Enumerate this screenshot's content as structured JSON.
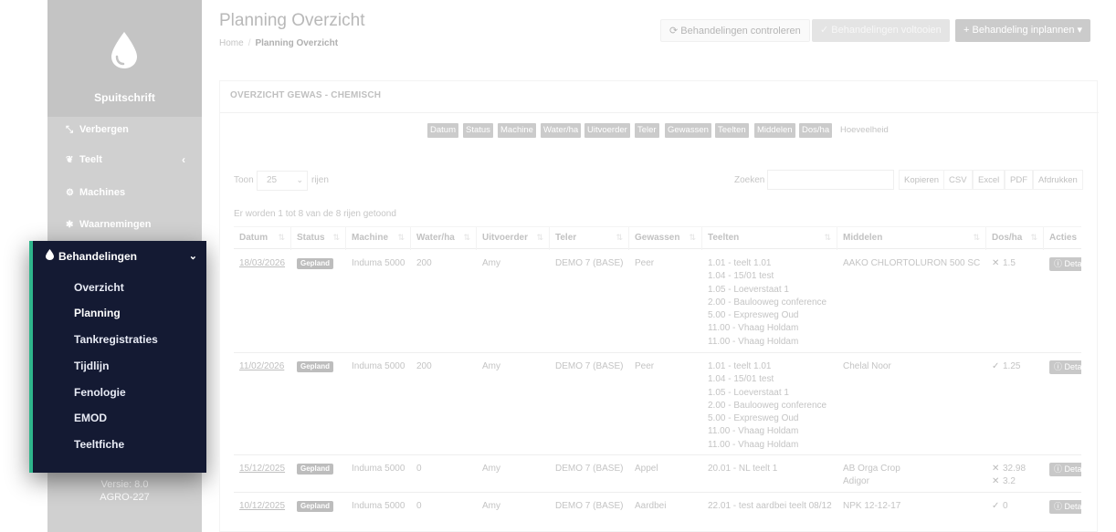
{
  "app": {
    "name": "Spuitschrift",
    "version": "Versie: 8.0",
    "build": "AGRO-227"
  },
  "sidebar": {
    "items": [
      {
        "icon": "compress-icon",
        "label": "Verbergen"
      },
      {
        "icon": "leaf-icon",
        "label": "Teelt"
      },
      {
        "icon": "tractor-icon",
        "label": "Machines"
      },
      {
        "icon": "bug-icon",
        "label": "Waarnemingen"
      }
    ],
    "active_section": {
      "label": "Behandelingen",
      "icon": "drop-icon",
      "subitems": [
        "Overzicht",
        "Planning",
        "Tankregistraties",
        "Tijdlijn",
        "Fenologie",
        "EMOD",
        "Teeltfiche"
      ],
      "active": "Planning"
    }
  },
  "header": {
    "title": "Planning Overzicht",
    "breadcrumb": [
      "Home",
      "Planning Overzicht"
    ],
    "buttons": {
      "check": "Behandelingen controleren",
      "complete": "Behandelingen voltooien",
      "plan": "Behandeling inplannen"
    }
  },
  "panel": {
    "title": "OVERZICHT GEWAS - CHEMISCH",
    "column_toggles": [
      "Datum",
      "Status",
      "Machine",
      "Water/ha",
      "Uitvoerder",
      "Teler",
      "Gewassen",
      "Teelten",
      "Middelen",
      "Dos/ha"
    ],
    "column_toggle_off": "Hoeveelheid",
    "show_label": "Toon",
    "show_value": "25",
    "rows_label": "rijen",
    "search_label": "Zoeken",
    "export": [
      "Kopieren",
      "CSV",
      "Excel",
      "PDF",
      "Afdrukken"
    ],
    "info": "Er worden 1 tot 8 van de 8 rijen getoond"
  },
  "table": {
    "headers": [
      "Datum",
      "Status",
      "Machine",
      "Water/ha",
      "Uitvoerder",
      "Teler",
      "Gewassen",
      "Teelten",
      "Middelen",
      "Dos/ha",
      "Acties"
    ],
    "rows": [
      {
        "date": "18/03/2026",
        "status": "Gepland",
        "machine": "Induma 5000",
        "water": "200",
        "uitvoerder": "Amy",
        "teler": "DEMO 7 (BASE)",
        "gewas": "Peer",
        "teelten": [
          "1.01 - teelt 1.01",
          "1.04 - 15/01 test",
          "1.05 - Loeverstaat 1",
          "2.00 - Baulooweg conference",
          "5.00 - Expresweg Oud",
          "11.00 - Vhaag Holdam",
          "11.00 - Vhaag Holdam"
        ],
        "middelen": [
          "AAKO CHLORTOLURON 500 SC"
        ],
        "dos": [
          {
            "mark": "✕",
            "value": "1.5"
          }
        ],
        "action": "Details"
      },
      {
        "date": "11/02/2026",
        "status": "Gepland",
        "machine": "Induma 5000",
        "water": "200",
        "uitvoerder": "Amy",
        "teler": "DEMO 7 (BASE)",
        "gewas": "Peer",
        "teelten": [
          "1.01 - teelt 1.01",
          "1.04 - 15/01 test",
          "1.05 - Loeverstaat 1",
          "2.00 - Baulooweg conference",
          "5.00 - Expresweg Oud",
          "11.00 - Vhaag Holdam",
          "11.00 - Vhaag Holdam"
        ],
        "middelen": [
          "Chelal Noor"
        ],
        "dos": [
          {
            "mark": "✓",
            "value": "1.25"
          }
        ],
        "action": "Details"
      },
      {
        "date": "15/12/2025",
        "status": "Gepland",
        "machine": "Induma 5000",
        "water": "0",
        "uitvoerder": "Amy",
        "teler": "DEMO 7 (BASE)",
        "gewas": "Appel",
        "teelten": [
          "20.01 - NL teelt 1"
        ],
        "middelen": [
          "AB Orga Crop",
          "Adigor"
        ],
        "dos": [
          {
            "mark": "✕",
            "value": "32.98"
          },
          {
            "mark": "✕",
            "value": "3.2"
          }
        ],
        "action": "Details"
      },
      {
        "date": "10/12/2025",
        "status": "Gepland",
        "machine": "Induma 5000",
        "water": "0",
        "uitvoerder": "Amy",
        "teler": "DEMO 7 (BASE)",
        "gewas": "Aardbei",
        "teelten": [
          "22.01 - test aardbei teelt 08/12"
        ],
        "middelen": [
          "NPK 12-12-17"
        ],
        "dos": [
          {
            "mark": "✓",
            "value": "0"
          }
        ],
        "action": "Details"
      }
    ]
  }
}
